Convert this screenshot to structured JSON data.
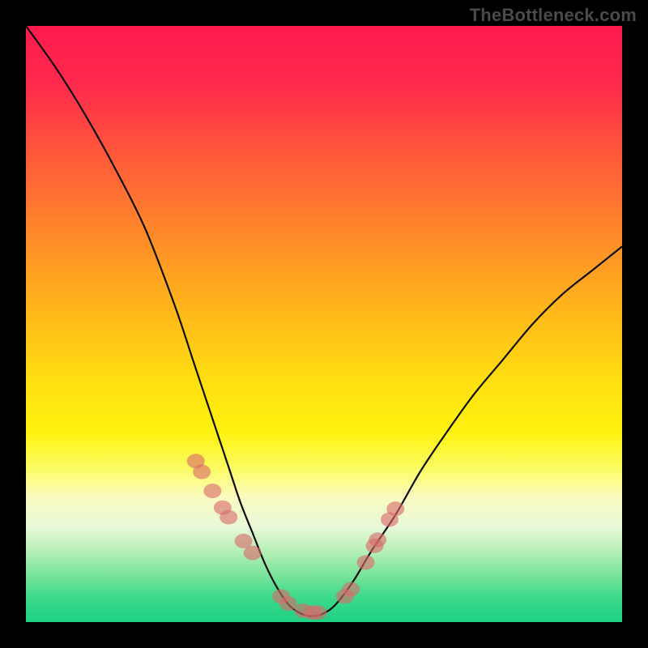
{
  "watermark": "TheBottleneck.com",
  "chart_data": {
    "type": "line",
    "title": "",
    "xlabel": "",
    "ylabel": "",
    "xlim": [
      0,
      100
    ],
    "ylim": [
      0,
      100
    ],
    "series": [
      {
        "name": "bottleneck-curve",
        "x": [
          0,
          5,
          10,
          15,
          20,
          25,
          28,
          30,
          32,
          34,
          36,
          38,
          40,
          42,
          44,
          46,
          48,
          50,
          52,
          55,
          58,
          62,
          66,
          70,
          75,
          80,
          85,
          90,
          95,
          100
        ],
        "y": [
          100,
          93,
          85,
          76,
          66,
          53,
          44,
          38,
          32,
          26,
          20,
          15,
          10,
          6,
          3,
          1.5,
          1,
          1.5,
          3,
          7,
          12,
          18,
          25,
          31,
          38,
          44,
          50,
          55,
          59,
          63
        ]
      }
    ],
    "markers": {
      "name": "highlight-points",
      "x": [
        28.5,
        29.5,
        31.3,
        33.0,
        34.0,
        36.5,
        38.0,
        42.8,
        44.0,
        46.5,
        48.0,
        49.0,
        53.5,
        54.5,
        57.0,
        58.5,
        59.0,
        61.0,
        62.0
      ],
      "y": [
        27.0,
        25.2,
        22.0,
        19.2,
        17.6,
        13.6,
        11.6,
        4.3,
        3.1,
        1.9,
        1.6,
        1.6,
        4.3,
        5.5,
        10.0,
        12.8,
        13.8,
        17.2,
        19.0
      ]
    }
  }
}
